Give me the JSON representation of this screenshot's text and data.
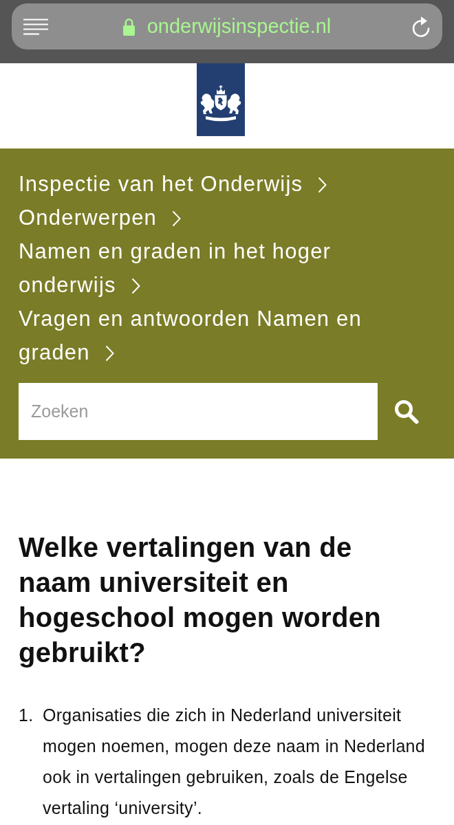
{
  "browser": {
    "url": "onderwijsinspectie.nl"
  },
  "breadcrumbs": [
    {
      "label": "Inspectie van het Onderwijs"
    },
    {
      "label": "Onderwerpen"
    },
    {
      "label": "Namen en graden in het hoger onderwijs"
    },
    {
      "label": "Vragen en antwoorden Namen en graden"
    }
  ],
  "search": {
    "placeholder": "Zoeken"
  },
  "heading": "Welke vertalingen van de naam universiteit en hogeschool mogen worden gebruikt?",
  "answers": [
    {
      "number": "1.",
      "text": "Organisaties die zich in Nederland universiteit mogen noemen, mogen deze naam in Nederland ook in vertalingen gebruiken, zoals de Engelse vertaling ‘university’."
    }
  ]
}
